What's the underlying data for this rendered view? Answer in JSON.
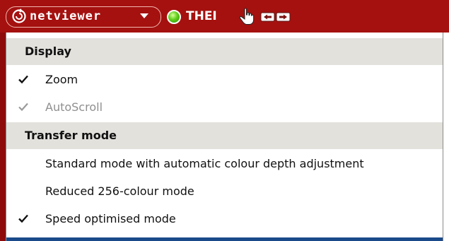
{
  "toolbar": {
    "app_name": "netviewer",
    "host": "THEI",
    "colors": {
      "bar": "#a4110f",
      "status_online": "#5fcf1a"
    },
    "icons": [
      "netviewer-logo-icon",
      "chevron-down-icon",
      "status-online-icon",
      "hand-pointer-icon",
      "transfer-icon"
    ]
  },
  "menu": {
    "display": {
      "header": "Display",
      "items": [
        {
          "label": "Zoom",
          "checked": true,
          "enabled": true
        },
        {
          "label": "AutoScroll",
          "checked": true,
          "enabled": false
        }
      ]
    },
    "transfer": {
      "header": "Transfer mode",
      "items": [
        {
          "label": "Standard mode with automatic colour depth adjustment",
          "checked": false,
          "enabled": true
        },
        {
          "label": "Reduced 256-colour mode",
          "checked": false,
          "enabled": true
        },
        {
          "label": "Speed optimised mode",
          "checked": true,
          "enabled": true
        }
      ]
    }
  }
}
